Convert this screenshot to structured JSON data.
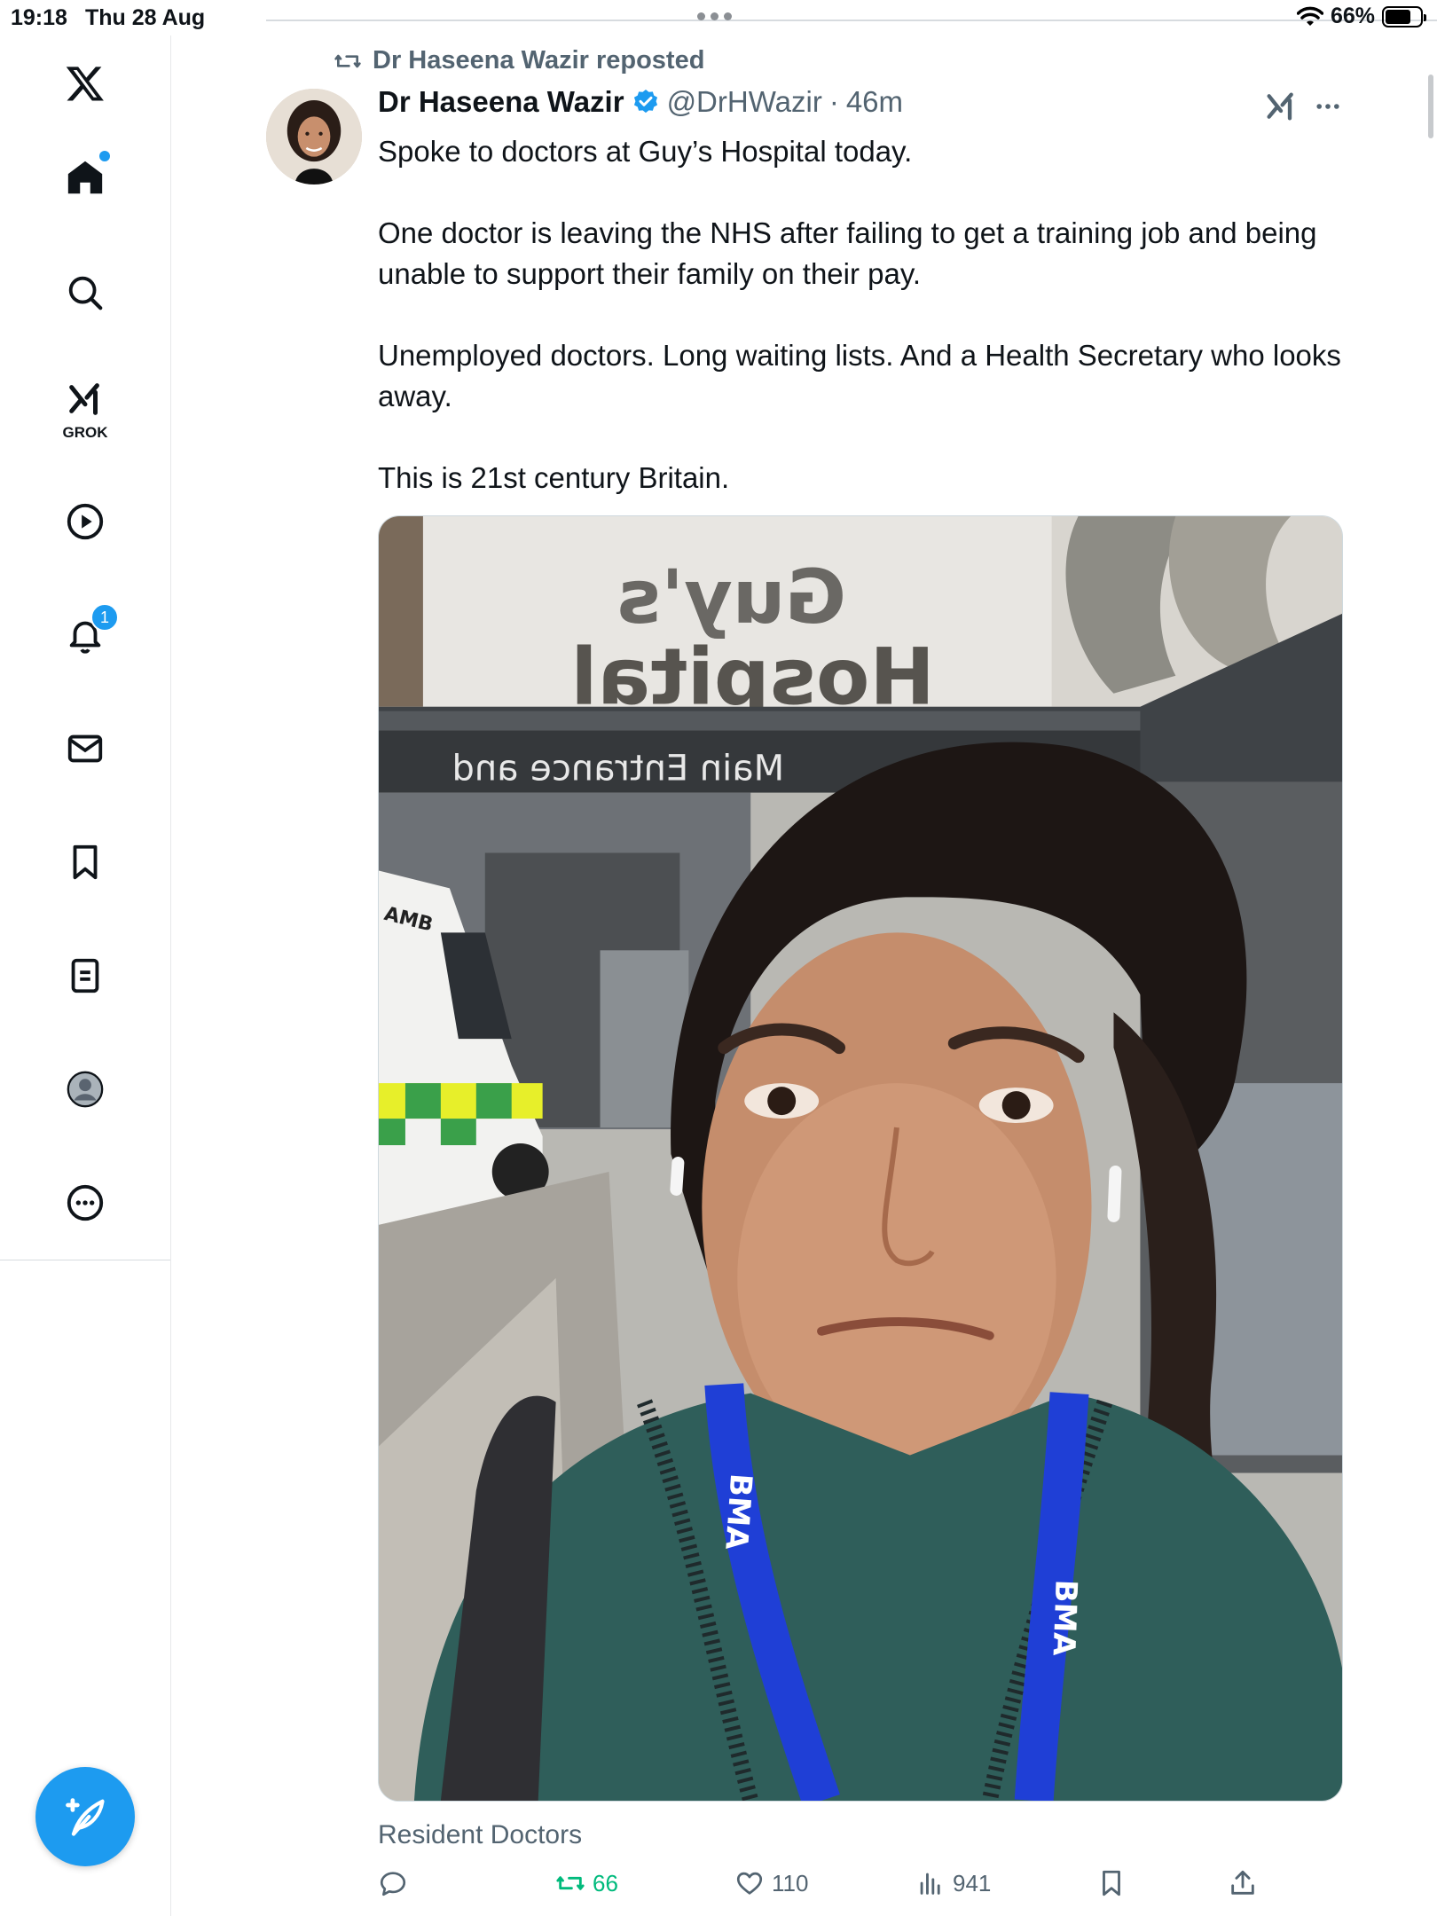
{
  "status_bar": {
    "time": "19:18",
    "date": "Thu 28 Aug",
    "battery": "66%",
    "battery_level": 0.66
  },
  "sidebar": {
    "items": [
      {
        "icon": "x-logo-icon"
      },
      {
        "icon": "home-icon",
        "has_dot": true
      },
      {
        "icon": "search-icon"
      },
      {
        "icon": "grok-icon",
        "label": "GROK"
      },
      {
        "icon": "play-icon"
      },
      {
        "icon": "bell-icon",
        "badge": "1"
      },
      {
        "icon": "mail-icon"
      },
      {
        "icon": "bookmark-icon"
      },
      {
        "icon": "list-icon"
      },
      {
        "icon": "profile-icon"
      },
      {
        "icon": "more-circle-icon"
      }
    ],
    "compose_icon": "compose-icon"
  },
  "tweet": {
    "repost_label": "Dr Haseena Wazir reposted",
    "display_name": "Dr Haseena Wazir",
    "verified": true,
    "handle": "@DrHWazir",
    "separator": "·",
    "time": "46m",
    "paragraphs": [
      "Spoke to doctors at Guy’s Hospital today.",
      "One doctor is leaving the NHS after failing to get a training job and being unable to support their family on their pay.",
      "Unemployed doctors. Long waiting lists. And a Health Secretary who looks away.",
      "This is 21st century Britain."
    ],
    "media": {
      "sign_top": "Guy's",
      "sign_bottom": "Hospital",
      "entrance_sign": "Main Entrance and",
      "van_label": "AMB",
      "lanyard_text": "BMA"
    },
    "caption": "Resident Doctors",
    "metrics": {
      "replies": "",
      "retweets": "66",
      "likes": "110",
      "views": "941"
    }
  },
  "colors": {
    "accent": "#1d9bf0",
    "retweet": "#00ba7c",
    "muted": "#536471"
  }
}
